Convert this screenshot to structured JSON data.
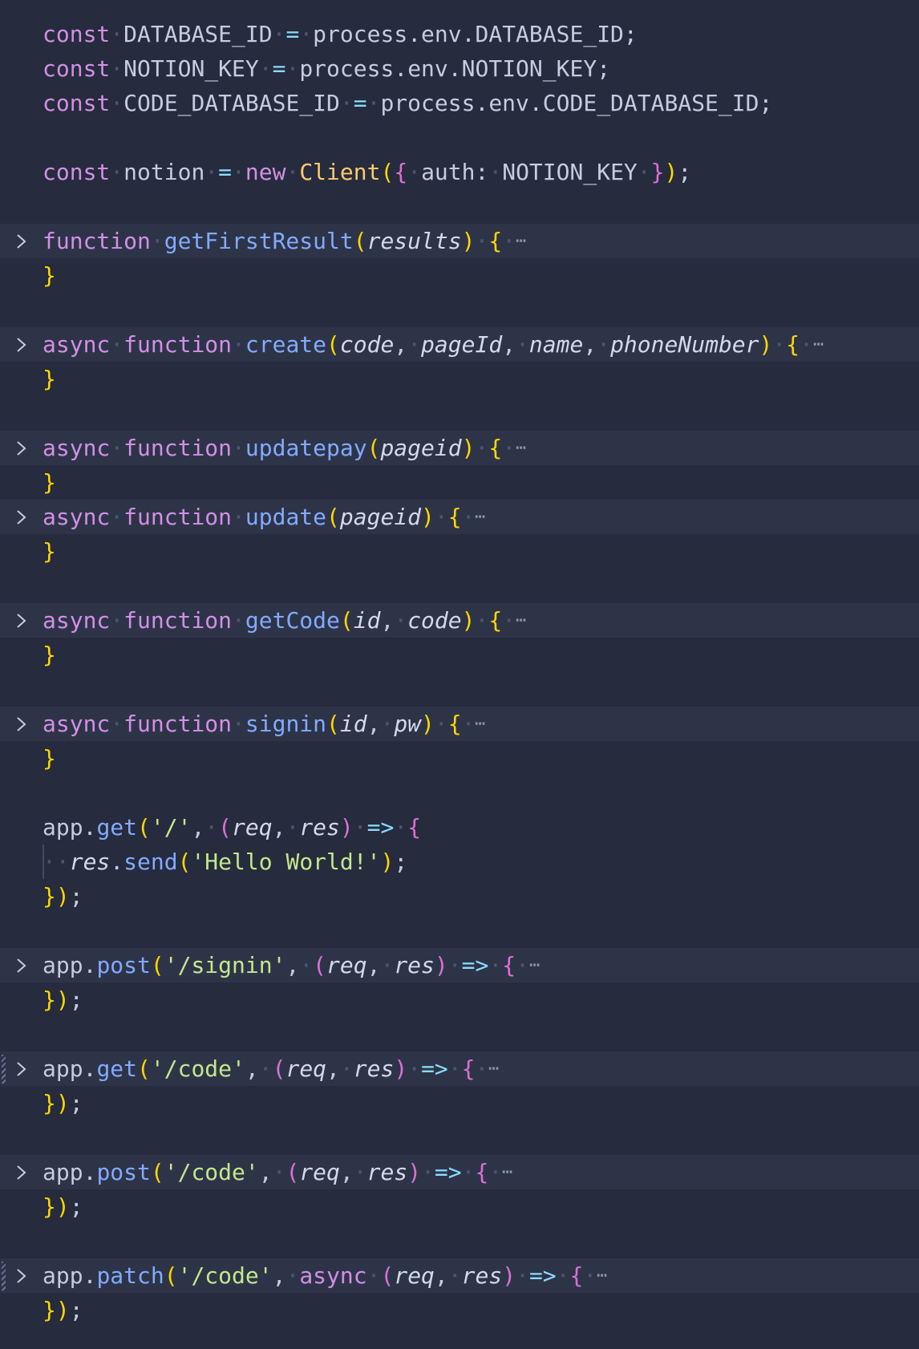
{
  "editor": {
    "language": "JavaScript",
    "theme": "dark",
    "colors": {
      "background": "#262b3d",
      "folded_line_background": "#2e3448",
      "keyword": "#d28fe6",
      "function_name": "#82aaff",
      "class_name": "#ffcb6b",
      "string": "#c3e88d",
      "bracket_level_1": "#ffd700",
      "bracket_level_2": "#da70d6",
      "bracket_level_3": "#179fff",
      "operator": "#89ddff",
      "text": "#c6cbe0"
    },
    "icons": {
      "fold": "chevron-right-icon",
      "collapsed": "ellipsis-icon",
      "change_marker": "modified-gutter-marker"
    },
    "lines": [
      {
        "text": "const DATABASE_ID = process.env.DATABASE_ID;"
      },
      {
        "text": "const NOTION_KEY = process.env.NOTION_KEY;"
      },
      {
        "text": "const CODE_DATABASE_ID = process.env.CODE_DATABASE_ID;"
      },
      {
        "text": ""
      },
      {
        "text": "const notion = new Client({ auth: NOTION_KEY });"
      },
      {
        "text": ""
      },
      {
        "text": "function getFirstResult(results) {",
        "folded": true,
        "collapsed_indicator": "⋯"
      },
      {
        "text": "}"
      },
      {
        "text": ""
      },
      {
        "text": "async function create(code, pageId, name, phoneNumber) {",
        "folded": true,
        "collapsed_indicator": "⋯"
      },
      {
        "text": "}"
      },
      {
        "text": ""
      },
      {
        "text": "async function updatepay(pageid) {",
        "folded": true,
        "collapsed_indicator": "⋯"
      },
      {
        "text": "}"
      },
      {
        "text": "async function update(pageid) {",
        "folded": true,
        "collapsed_indicator": "⋯"
      },
      {
        "text": "}"
      },
      {
        "text": ""
      },
      {
        "text": "async function getCode(id, code) {",
        "folded": true,
        "collapsed_indicator": "⋯"
      },
      {
        "text": "}"
      },
      {
        "text": ""
      },
      {
        "text": "async function signin(id, pw) {",
        "folded": true,
        "collapsed_indicator": "⋯"
      },
      {
        "text": "}"
      },
      {
        "text": ""
      },
      {
        "text": "app.get('/', (req, res) => {"
      },
      {
        "text": "  res.send('Hello World!');"
      },
      {
        "text": "});"
      },
      {
        "text": ""
      },
      {
        "text": "app.post('/signin', (req, res) => {",
        "folded": true,
        "collapsed_indicator": "⋯"
      },
      {
        "text": "});"
      },
      {
        "text": ""
      },
      {
        "text": "app.get('/code', (req, res) => {",
        "folded": true,
        "collapsed_indicator": "⋯",
        "modified": true
      },
      {
        "text": "});"
      },
      {
        "text": ""
      },
      {
        "text": "app.post('/code', (req, res) => {",
        "folded": true,
        "collapsed_indicator": "⋯"
      },
      {
        "text": "});"
      },
      {
        "text": ""
      },
      {
        "text": "app.patch('/code', async (req, res) => {",
        "folded": true,
        "collapsed_indicator": "⋯",
        "modified": true
      },
      {
        "text": "});"
      }
    ]
  }
}
